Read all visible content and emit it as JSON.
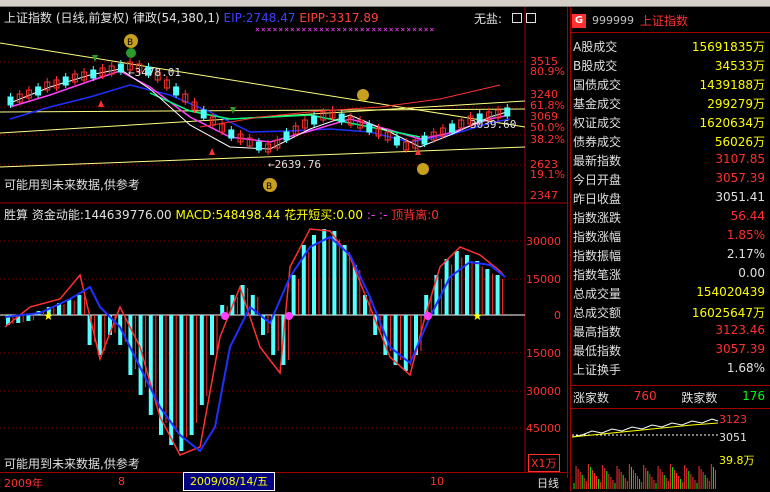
{
  "header": {
    "index_name": "上证指数",
    "period_mode": "(日线,前复权)",
    "indicator": "律政(54,380,1)",
    "eip": "EIP:2748.47",
    "eipp": "EIPP:3317.89",
    "status": "无盐:"
  },
  "price_axis": [
    "3515",
    "80.9%",
    "3240",
    "61.8%",
    "3069",
    "50.0%",
    "38.2%",
    "2623",
    "19.1%",
    "2347"
  ],
  "price_annotations": {
    "high": "3478.01",
    "low": "2639.76",
    "last": "3039.60"
  },
  "warning": "可能用到未来数据,供参考",
  "indicator_header": {
    "name": "胜算",
    "fund_label": "资金动能:144639776.00",
    "macd_label": "MACD:548498.44",
    "short_label": "花开短买:0.00",
    "dash": ":- :-",
    "top_label": "顶背离:0"
  },
  "volume_axis": [
    "30000",
    "15000",
    "0",
    "15000",
    "30000",
    "45000"
  ],
  "volume_unit": "X1万",
  "bottom": {
    "year": "2009年",
    "month_8": "8",
    "selected_date": "2009/08/14/五",
    "month_10": "10",
    "period": "日线"
  },
  "panel": {
    "code": "999999",
    "name": "上证指数",
    "rows": [
      {
        "k": "A股成交",
        "v": "15691835万",
        "c": "#ffff00"
      },
      {
        "k": "B股成交",
        "v": "34533万",
        "c": "#ffff00"
      },
      {
        "k": "国债成交",
        "v": "1439188万",
        "c": "#ffff00"
      },
      {
        "k": "基金成交",
        "v": "299279万",
        "c": "#ffff00"
      },
      {
        "k": "权证成交",
        "v": "1620634万",
        "c": "#ffff00"
      },
      {
        "k": "债券成交",
        "v": "56026万",
        "c": "#ffff00"
      },
      {
        "k": "最新指数",
        "v": "3107.85",
        "c": "#ff3030"
      },
      {
        "k": "今日开盘",
        "v": "3057.39",
        "c": "#ff3030"
      },
      {
        "k": "昨日收盘",
        "v": "3051.41",
        "c": "#e0e0e0"
      },
      {
        "k": "指数涨跌",
        "v": "56.44",
        "c": "#ff3030"
      },
      {
        "k": "指数涨幅",
        "v": "1.85%",
        "c": "#ff3030"
      },
      {
        "k": "指数振幅",
        "v": "2.17%",
        "c": "#e0e0e0"
      },
      {
        "k": "指数笔涨",
        "v": "0.00",
        "c": "#e0e0e0"
      },
      {
        "k": "总成交量",
        "v": "154020439",
        "c": "#ffff00"
      },
      {
        "k": "总成交额",
        "v": "16025647万",
        "c": "#ffff00"
      },
      {
        "k": "最高指数",
        "v": "3123.46",
        "c": "#ff3030"
      },
      {
        "k": "最低指数",
        "v": "3057.39",
        "c": "#ff3030"
      },
      {
        "k": "上证换手",
        "v": "1.68%",
        "c": "#e0e0e0"
      }
    ],
    "up_label": "涨家数",
    "up_count": "760",
    "down_label": "跌家数",
    "down_count": "176",
    "mini_high": "3123",
    "mini_base": "3051",
    "mini_vol": "39.8万"
  },
  "colors": {
    "up": "#ff3030",
    "down": "#54ffff",
    "ma_white": "#ffffff",
    "ma_yellow": "#ffff00",
    "ma_magenta": "#ff40ff",
    "ma_blue": "#2030ff",
    "ma_green": "#00ff80"
  }
}
